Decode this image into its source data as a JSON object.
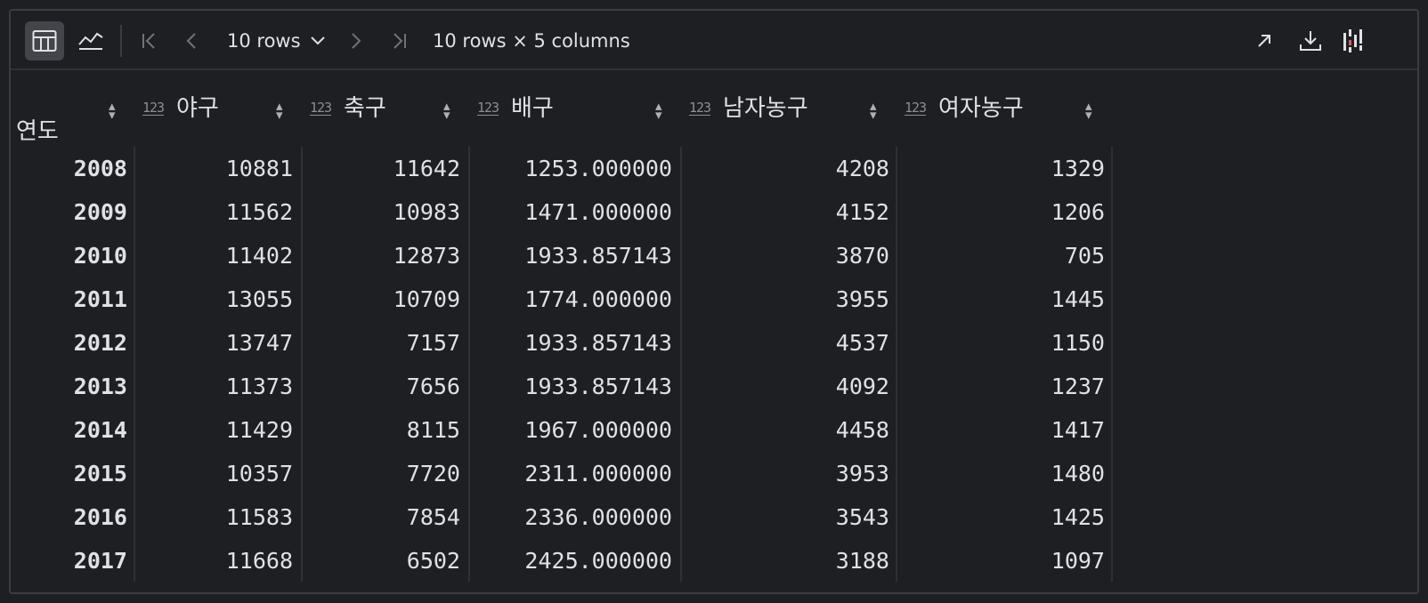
{
  "toolbar": {
    "table_view_icon": "table-icon",
    "chart_view_icon": "line-chart-icon",
    "rows_label": "10 rows",
    "summary": "10 rows × 5 columns",
    "icons": [
      "first-page-icon",
      "prev-page-icon",
      "next-page-icon",
      "last-page-icon",
      "open-external-icon",
      "download-icon",
      "column-settings-icon"
    ]
  },
  "table": {
    "index_header": "연도",
    "type_badge": "123",
    "columns": [
      {
        "name": "야구"
      },
      {
        "name": "축구"
      },
      {
        "name": "배구"
      },
      {
        "name": "남자농구"
      },
      {
        "name": "여자농구"
      }
    ],
    "rows": [
      {
        "year": "2008",
        "cells": [
          "10881",
          "11642",
          "1253.000000",
          "4208",
          "1329"
        ]
      },
      {
        "year": "2009",
        "cells": [
          "11562",
          "10983",
          "1471.000000",
          "4152",
          "1206"
        ]
      },
      {
        "year": "2010",
        "cells": [
          "11402",
          "12873",
          "1933.857143",
          "3870",
          "705"
        ]
      },
      {
        "year": "2011",
        "cells": [
          "13055",
          "10709",
          "1774.000000",
          "3955",
          "1445"
        ]
      },
      {
        "year": "2012",
        "cells": [
          "13747",
          "7157",
          "1933.857143",
          "4537",
          "1150"
        ]
      },
      {
        "year": "2013",
        "cells": [
          "11373",
          "7656",
          "1933.857143",
          "4092",
          "1237"
        ]
      },
      {
        "year": "2014",
        "cells": [
          "11429",
          "8115",
          "1967.000000",
          "4458",
          "1417"
        ]
      },
      {
        "year": "2015",
        "cells": [
          "10357",
          "7720",
          "2311.000000",
          "3953",
          "1480"
        ]
      },
      {
        "year": "2016",
        "cells": [
          "11583",
          "7854",
          "2336.000000",
          "3543",
          "1425"
        ]
      },
      {
        "year": "2017",
        "cells": [
          "11668",
          "6502",
          "2425.000000",
          "3188",
          "1097"
        ]
      }
    ]
  }
}
